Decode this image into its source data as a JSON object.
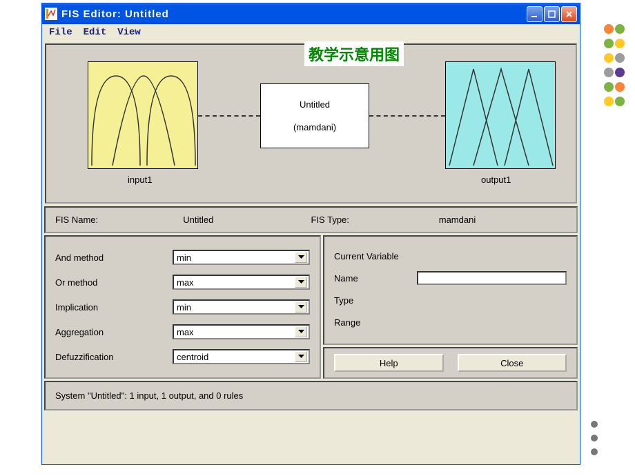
{
  "window": {
    "title": "FIS Editor: Untitled"
  },
  "menubar": {
    "file": "File",
    "edit": "Edit",
    "view": "View"
  },
  "overlay": "教学示意用图",
  "diagram": {
    "input_label": "input1",
    "output_label": "output1",
    "center_name": "Untitled",
    "center_type": "(mamdani)"
  },
  "info": {
    "fis_name_label": "FIS Name:",
    "fis_name_value": "Untitled",
    "fis_type_label": "FIS Type:",
    "fis_type_value": "mamdani"
  },
  "methods": {
    "and_label": "And method",
    "and_value": "min",
    "or_label": "Or method",
    "or_value": "max",
    "imp_label": "Implication",
    "imp_value": "min",
    "agg_label": "Aggregation",
    "agg_value": "max",
    "defuzz_label": "Defuzzification",
    "defuzz_value": "centroid"
  },
  "curvar": {
    "title": "Current Variable",
    "name_label": "Name",
    "type_label": "Type",
    "range_label": "Range"
  },
  "buttons": {
    "help": "Help",
    "close": "Close"
  },
  "status": "System \"Untitled\": 1 input, 1 output, and 0 rules"
}
